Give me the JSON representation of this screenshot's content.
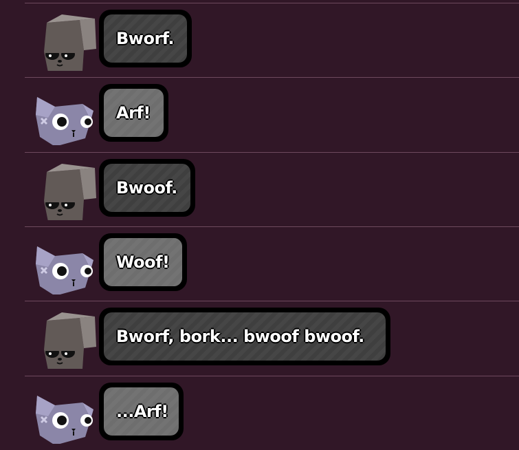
{
  "messages": [
    {
      "speaker": "brick-dog",
      "text": "Bworf."
    },
    {
      "speaker": "cat",
      "text": "Arf!"
    },
    {
      "speaker": "brick-dog",
      "text": "Bwoof."
    },
    {
      "speaker": "cat",
      "text": "Woof!"
    },
    {
      "speaker": "brick-dog",
      "text": "Bworf, bork... bwoof bwoof."
    },
    {
      "speaker": "cat",
      "text": "...Arf!"
    }
  ],
  "colors": {
    "background": "#311727",
    "divider": "#6e4a5e",
    "bubble_dark": "#3f3f3f",
    "bubble_light": "#6e6e6e",
    "bubble_border": "#000000",
    "text": "#ffffff"
  },
  "icons": {
    "brick-dog": "grey-block-dog-face-icon",
    "cat": "lavender-cat-face-icon"
  }
}
